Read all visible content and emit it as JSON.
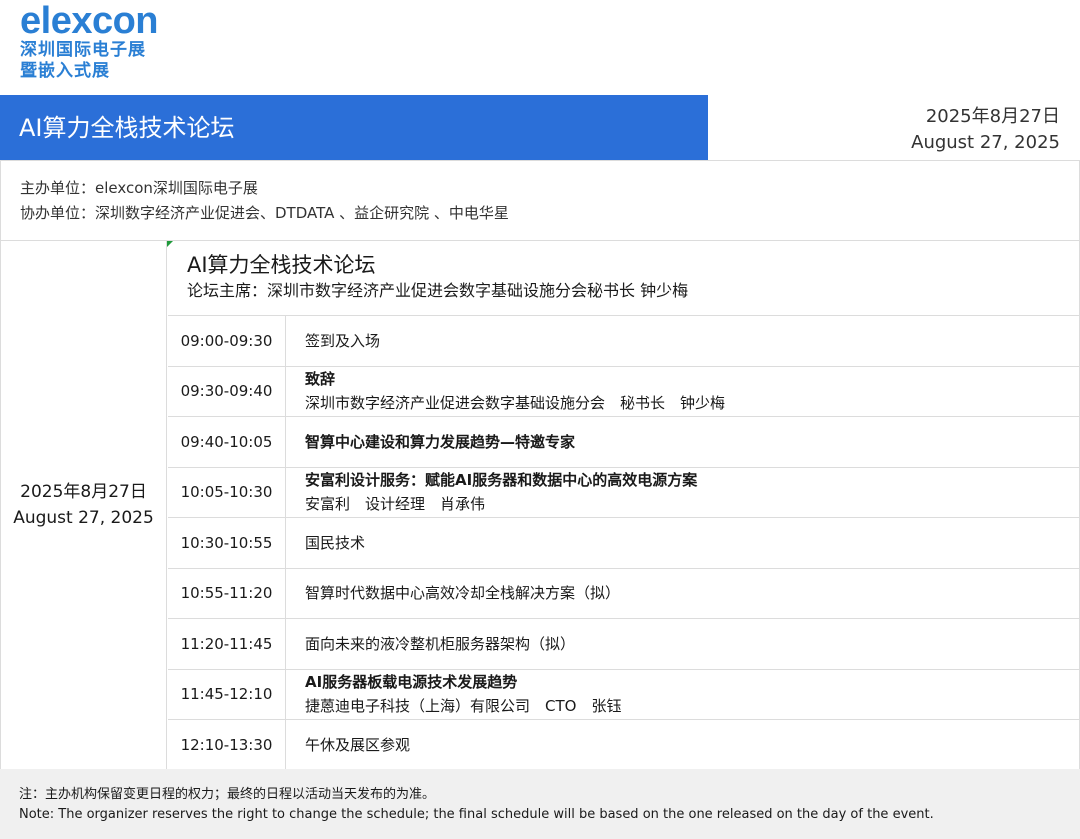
{
  "logo": {
    "wordmark": "elexcon",
    "line1": "深圳国际电子展",
    "line2": "暨嵌入式展"
  },
  "banner": {
    "title": "AI算力全栈技术论坛",
    "date_cn": "2025年8月27日",
    "date_en": "August 27, 2025"
  },
  "orgs": {
    "host": "主办单位：elexcon深圳国际电子展",
    "co_host": "协办单位：深圳数字经济产业促进会、DTDATA 、益企研究院 、中电华星"
  },
  "schedule": {
    "date_cn": "2025年8月27日",
    "date_en": "August 27, 2025",
    "forum_title": "AI算力全栈技术论坛",
    "forum_host": "论坛主席：深圳市数字经济产业促进会数字基础设施分会秘书长 钟少梅",
    "rows": [
      {
        "time": "09:00-09:30",
        "title": "签到及入场",
        "sub": ""
      },
      {
        "time": "09:30-09:40",
        "title": "致辞",
        "sub": "深圳市数字经济产业促进会数字基础设施分会　秘书长　钟少梅"
      },
      {
        "time": "09:40-10:05",
        "title": "智算中心建设和算力发展趋势—特邀专家",
        "sub": ""
      },
      {
        "time": "10:05-10:30",
        "title": "安富利设计服务：赋能AI服务器和数据中心的高效电源方案",
        "sub": "安富利　设计经理　肖承伟"
      },
      {
        "time": "10:30-10:55",
        "title": "国民技术",
        "sub": ""
      },
      {
        "time": "10:55-11:20",
        "title": "智算时代数据中心高效冷却全栈解决方案（拟）",
        "sub": ""
      },
      {
        "time": "11:20-11:45",
        "title": "面向未来的液冷整机柜服务器架构（拟）",
        "sub": ""
      },
      {
        "time": "11:45-12:10",
        "title": "AI服务器板载电源技术发展趋势",
        "sub": "捷蒽迪电子科技（上海）有限公司　CTO　张钰"
      },
      {
        "time": "12:10-13:30",
        "title": "午休及展区参观",
        "sub": ""
      }
    ]
  },
  "note": {
    "cn": "注：主办机构保留变更日程的权力；最终的日程以活动当天发布的为准。",
    "en": "Note: The organizer reserves the right to change the schedule; the final schedule will be based on the one released on the day of the event."
  }
}
